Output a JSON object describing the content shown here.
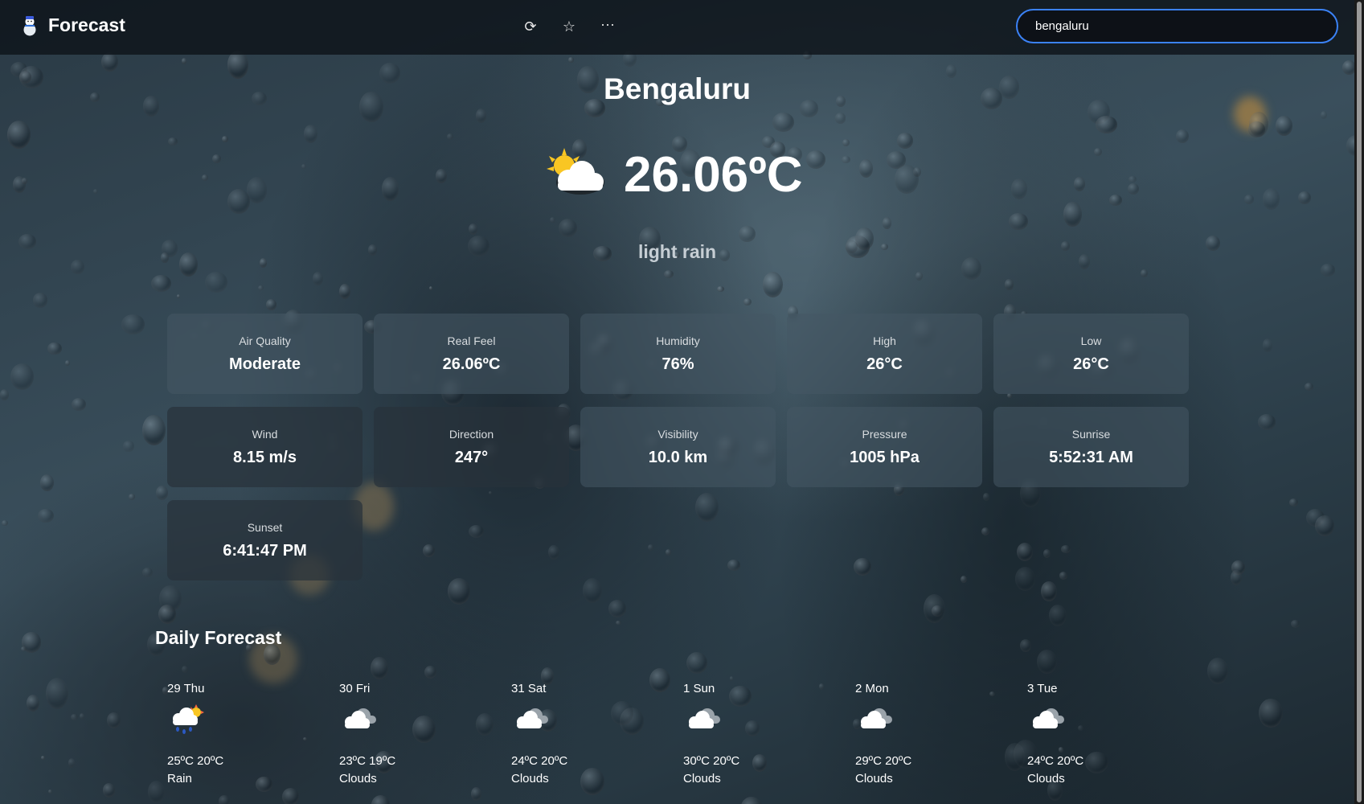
{
  "app": {
    "title": "Forecast",
    "logo_icon": "snowman-icon"
  },
  "header": {
    "actions": [
      {
        "name": "refresh-button",
        "icon": "refresh-icon",
        "glyph": "⟳"
      },
      {
        "name": "favorite-button",
        "icon": "star-icon",
        "glyph": "☆"
      },
      {
        "name": "more-button",
        "icon": "more-icon",
        "glyph": "···"
      }
    ],
    "search": {
      "value": "bengaluru",
      "placeholder": ""
    }
  },
  "current": {
    "city": "Bengaluru",
    "temperature": "26.06ºC",
    "icon": "partly-cloudy-icon",
    "description": "light rain"
  },
  "stats": [
    {
      "label": "Air Quality",
      "value": "Moderate"
    },
    {
      "label": "Real Feel",
      "value": "26.06ºC"
    },
    {
      "label": "Humidity",
      "value": "76%"
    },
    {
      "label": "High",
      "value": "26°C"
    },
    {
      "label": "Low",
      "value": "26°C"
    },
    {
      "label": "Wind",
      "value": "8.15 m/s"
    },
    {
      "label": "Direction",
      "value": "247°"
    },
    {
      "label": "Visibility",
      "value": "10.0 km"
    },
    {
      "label": "Pressure",
      "value": "1005 hPa"
    },
    {
      "label": "Sunrise",
      "value": "5:52:31 AM"
    },
    {
      "label": "Sunset",
      "value": "6:41:47 PM"
    }
  ],
  "daily": {
    "title": "Daily Forecast",
    "days": [
      {
        "day": "29 Thu",
        "temps": "25ºC 20ºC",
        "condition": "Rain",
        "icon": "rain-sun-icon"
      },
      {
        "day": "30 Fri",
        "temps": "23ºC 19ºC",
        "condition": "Clouds",
        "icon": "cloud-icon"
      },
      {
        "day": "31 Sat",
        "temps": "24ºC 20ºC",
        "condition": "Clouds",
        "icon": "cloud-icon"
      },
      {
        "day": "1 Sun",
        "temps": "30ºC 20ºC",
        "condition": "Clouds",
        "icon": "cloud-icon"
      },
      {
        "day": "2 Mon",
        "temps": "29ºC 20ºC",
        "condition": "Clouds",
        "icon": "cloud-icon"
      },
      {
        "day": "3 Tue",
        "temps": "24ºC 20ºC",
        "condition": "Clouds",
        "icon": "cloud-icon"
      }
    ]
  },
  "colors": {
    "accent": "#3b82f6",
    "header_bg": "#0e141a",
    "card_bg": "#465864"
  }
}
